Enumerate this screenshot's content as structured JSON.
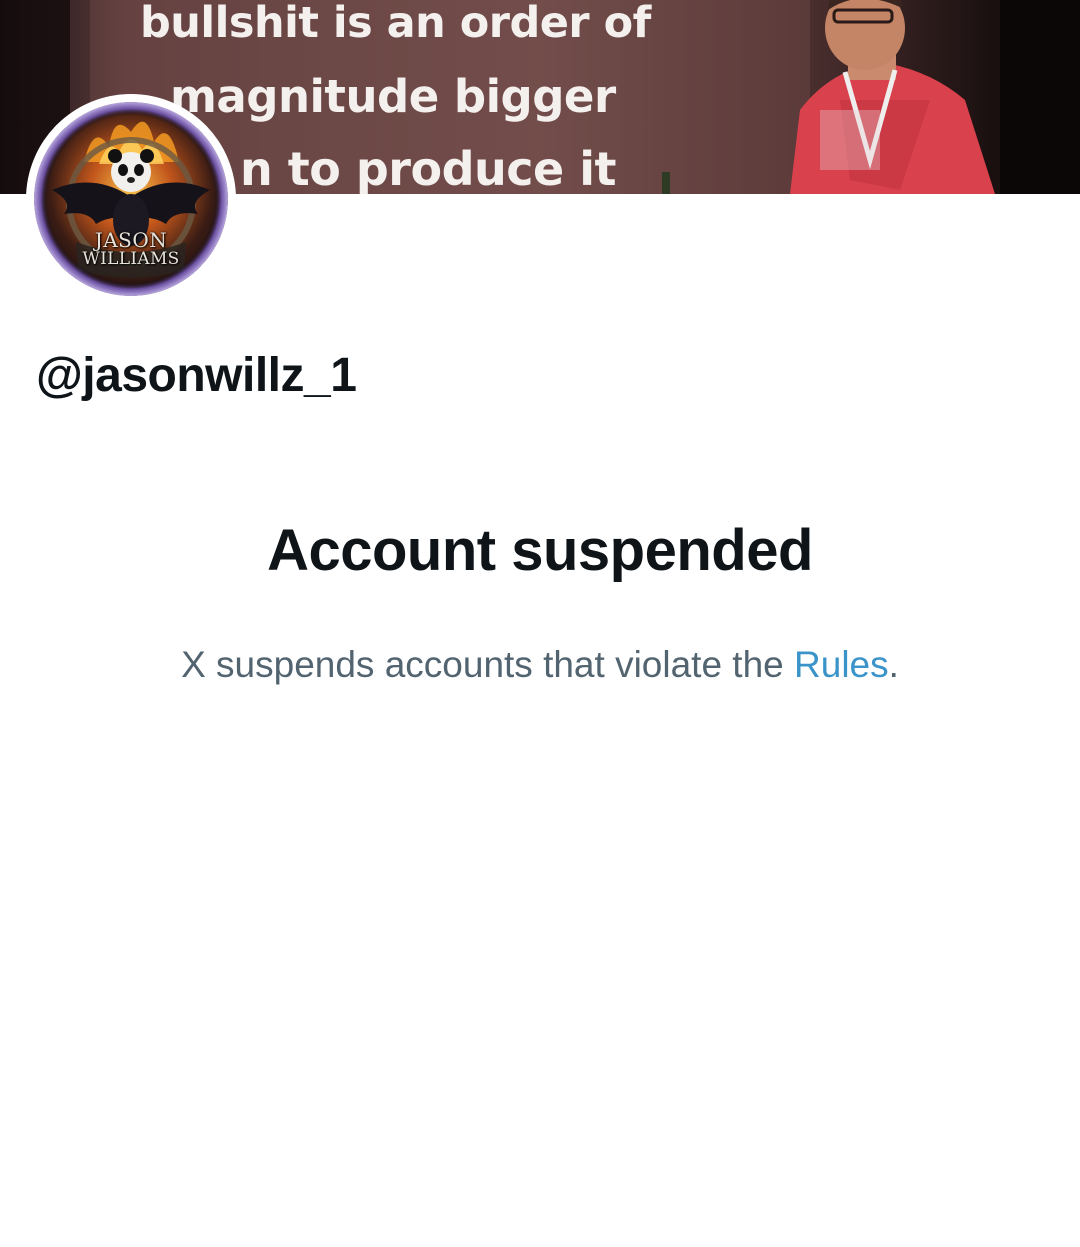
{
  "banner": {
    "slide_lines": [
      "bullshit is an order of",
      "magnitude bigger",
      "n to produce it"
    ]
  },
  "avatar": {
    "name_first": "JASON",
    "name_last": "WILLIAMS",
    "icon": "panda-eagle-logo"
  },
  "profile": {
    "handle": "@jasonwillz_1"
  },
  "suspension": {
    "title": "Account suspended",
    "desc_prefix": "X suspends accounts that violate the ",
    "rules_link": "Rules",
    "desc_suffix": "."
  },
  "colors": {
    "text_primary": "#0f1419",
    "text_secondary": "#536471",
    "link": "#3b94c9",
    "banner_bg": "#2a1c1e",
    "shirt_red": "#e0414e"
  }
}
